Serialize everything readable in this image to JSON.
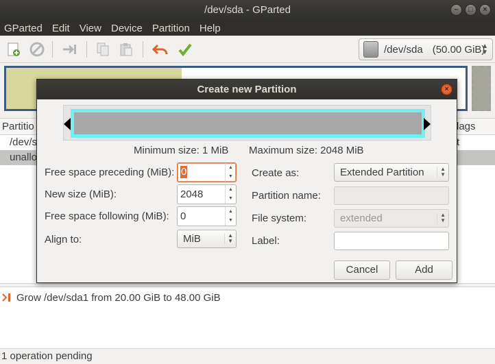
{
  "window": {
    "title": "/dev/sda - GParted"
  },
  "menu": [
    "GParted",
    "Edit",
    "View",
    "Device",
    "Partition",
    "Help"
  ],
  "toolbar": {
    "icons": [
      "new-partition-icon",
      "delete-icon",
      "resize-move-icon",
      "copy-icon",
      "paste-icon",
      "undo-icon",
      "apply-icon"
    ],
    "device_selector": {
      "device": "/dev/sda",
      "size": "(50.00 GiB)"
    }
  },
  "partition_list": {
    "header_partition": "Partitio",
    "header_flags": "lags",
    "rows": [
      {
        "name": "/dev/s",
        "trailing": "t",
        "selected": false
      },
      {
        "name": "unallo",
        "trailing": "",
        "selected": true
      }
    ]
  },
  "operations": {
    "items": [
      {
        "text": "Grow /dev/sda1 from 20.00 GiB to 48.00 GiB"
      }
    ]
  },
  "status": {
    "text": "1 operation pending"
  },
  "dialog": {
    "title": "Create new Partition",
    "min_size": "Minimum size: 1 MiB",
    "max_size": "Maximum size: 2048 MiB",
    "left_fields": {
      "free_preceding": {
        "label": "Free space preceding (MiB):",
        "value": "0"
      },
      "new_size": {
        "label": "New size (MiB):",
        "value": "2048"
      },
      "free_following": {
        "label": "Free space following (MiB):",
        "value": "0"
      },
      "align_to": {
        "label": "Align to:",
        "value": "MiB"
      }
    },
    "right_fields": {
      "create_as": {
        "label": "Create as:",
        "value": "Extended Partition"
      },
      "partition_name": {
        "label": "Partition name:",
        "value": ""
      },
      "file_system": {
        "label": "File system:",
        "value": "extended"
      },
      "label": {
        "label": "Label:",
        "value": ""
      }
    },
    "buttons": {
      "cancel": "Cancel",
      "add": "Add"
    }
  },
  "colors": {
    "titlebar": "#302f2c",
    "accent_focus": "#e46a30",
    "size_bar_border": "#71f0f4",
    "partition_border": "#3d5a80",
    "used_space": "#d8d79e"
  }
}
